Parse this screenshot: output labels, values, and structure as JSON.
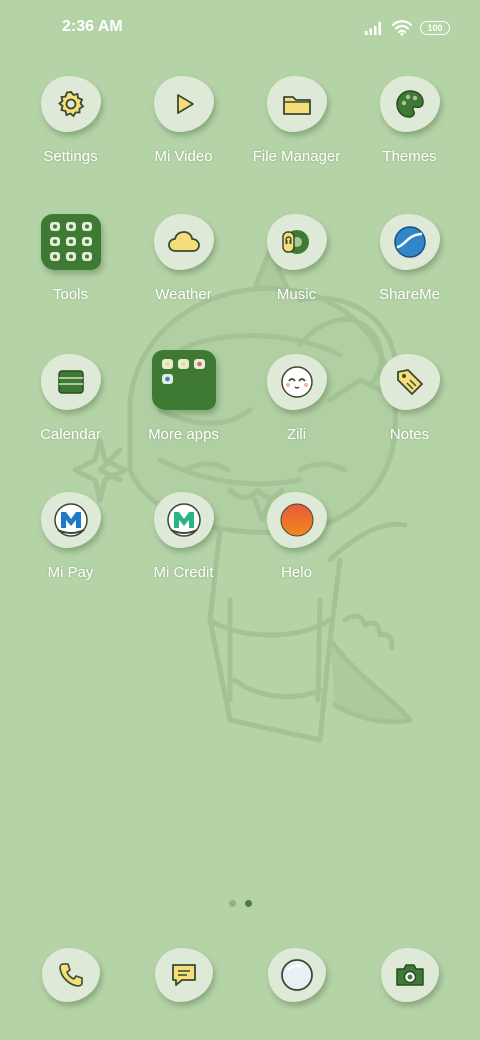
{
  "status_bar": {
    "time": "2:36 AM",
    "battery": "100",
    "icons": [
      "signal-icon",
      "wifi-icon",
      "battery-icon"
    ]
  },
  "apps": [
    {
      "label": "Settings",
      "icon": "gear-icon"
    },
    {
      "label": "Mi Video",
      "icon": "play-icon"
    },
    {
      "label": "File Manager",
      "icon": "folder-icon"
    },
    {
      "label": "Themes",
      "icon": "palette-icon"
    },
    {
      "label": "Tools",
      "icon": "tools-folder-icon"
    },
    {
      "label": "Weather",
      "icon": "cloud-icon"
    },
    {
      "label": "Music",
      "icon": "music-icon"
    },
    {
      "label": "ShareMe",
      "icon": "shareme-icon"
    },
    {
      "label": "Calendar",
      "icon": "calendar-icon"
    },
    {
      "label": "More apps",
      "icon": "apps-folder-icon"
    },
    {
      "label": "Zili",
      "icon": "zili-face-icon"
    },
    {
      "label": "Notes",
      "icon": "tag-icon"
    },
    {
      "label": "Mi Pay",
      "icon": "mi-pay-icon"
    },
    {
      "label": "Mi Credit",
      "icon": "mi-credit-icon"
    },
    {
      "label": "Helo",
      "icon": "helo-icon"
    }
  ],
  "dock": [
    {
      "icon": "phone-icon"
    },
    {
      "icon": "message-icon"
    },
    {
      "icon": "browser-icon"
    },
    {
      "icon": "camera-icon"
    }
  ],
  "pager": {
    "pages": 2,
    "active": 2
  },
  "colors": {
    "background": "#b4d3a7",
    "icon_bg": "#dfe9d8",
    "accent_yellow": "#f6df7a",
    "accent_green": "#3f7a34"
  }
}
